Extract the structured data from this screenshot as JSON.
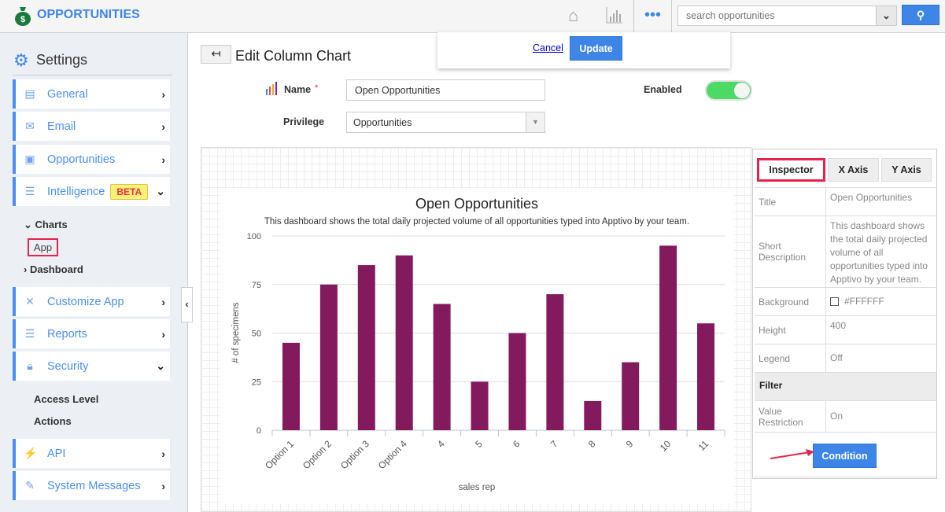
{
  "header": {
    "app_title": "OPPORTUNITIES",
    "search_placeholder": "search opportunities"
  },
  "popup": {
    "cancel": "Cancel",
    "update": "Update"
  },
  "sidebar": {
    "title": "Settings",
    "items": [
      {
        "label": "General",
        "icon": "monitor-icon"
      },
      {
        "label": "Email",
        "icon": "envelope-icon"
      },
      {
        "label": "Opportunities",
        "icon": "window-icon"
      },
      {
        "label": "Intelligence",
        "icon": "list-icon",
        "badge": "BETA"
      },
      {
        "label": "Customize App",
        "icon": "tools-icon"
      },
      {
        "label": "Reports",
        "icon": "report-icon"
      },
      {
        "label": "Security",
        "icon": "lock-icon"
      },
      {
        "label": "API",
        "icon": "plug-icon"
      },
      {
        "label": "System Messages",
        "icon": "message-icon"
      }
    ],
    "intelligence_sub": {
      "charts": "Charts",
      "app": "App",
      "dashboard": "Dashboard"
    },
    "security_sub": [
      "Access Level",
      "Actions"
    ]
  },
  "form": {
    "page_title": "Edit Column Chart",
    "name_label": "Name",
    "required": "*",
    "name_value": "Open Opportunities",
    "enabled_label": "Enabled",
    "enabled": true,
    "privilege_label": "Privilege",
    "privilege_value": "Opportunities"
  },
  "inspector": {
    "tabs": [
      "Inspector",
      "X Axis",
      "Y Axis"
    ],
    "rows": [
      {
        "k": "Title",
        "v": "Open Opportunities"
      },
      {
        "k": "Short Description",
        "v": "This dashboard shows the total daily projected volume of all opportunities typed into Apptivo by your team."
      },
      {
        "k": "Background",
        "v": "#FFFFFF"
      },
      {
        "k": "Height",
        "v": "400"
      },
      {
        "k": "Legend",
        "v": "Off"
      }
    ],
    "filter": "Filter",
    "value_restriction": {
      "k": "Value Restriction",
      "v": "On"
    },
    "condition": "Condition"
  },
  "chart_data": {
    "type": "bar",
    "title": "Open Opportunities",
    "subtitle": "This dashboard shows the total daily projected volume of all opportunities typed into Apptivo by your team.",
    "categories": [
      "Option 1",
      "Option 2",
      "Option 3",
      "Option 4",
      "4",
      "5",
      "6",
      "7",
      "8",
      "9",
      "10",
      "11"
    ],
    "values": [
      45,
      75,
      85,
      90,
      65,
      25,
      50,
      70,
      15,
      35,
      95,
      55
    ],
    "xlabel": "sales rep",
    "ylabel": "# of specimens",
    "ylim": [
      0,
      100
    ],
    "yticks": [
      0,
      25,
      50,
      75,
      100
    ],
    "bar_color": "#841a5e",
    "grid": true,
    "legend": "off"
  }
}
